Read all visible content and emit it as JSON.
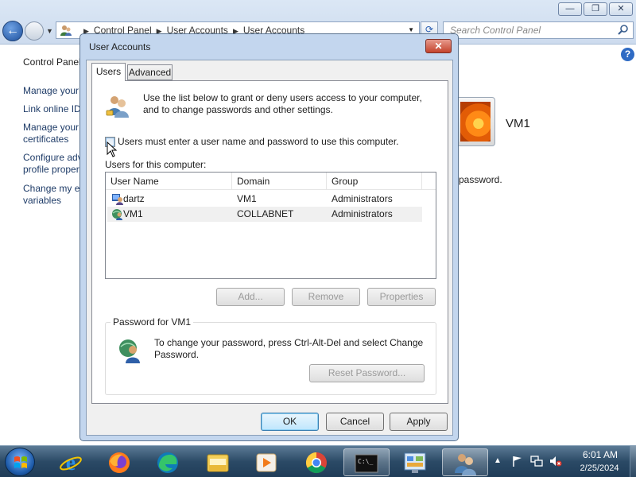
{
  "control_panel": {
    "breadcrumb": [
      "Control Panel",
      "User Accounts",
      "User Accounts"
    ],
    "search_placeholder": "Search Control Panel",
    "sidebar": {
      "home": "Control Panel",
      "links": [
        "Manage your",
        "Link online ID",
        "Manage your",
        "certificates",
        "Configure adv",
        "profile proper",
        "Change my e",
        "variables"
      ]
    },
    "user_tile_name": "VM1",
    "visible_text_fragment": "password."
  },
  "dialog": {
    "title": "User Accounts",
    "tabs": [
      "Users",
      "Advanced"
    ],
    "active_tab": "Users",
    "intro_line1": "Use the list below to grant or deny users access to your computer,",
    "intro_line2": "and to change passwords and other settings.",
    "must_enter_label": "Users must enter a user name and password to use this computer.",
    "must_enter_checked": false,
    "users_label": "Users for this computer:",
    "columns": [
      "User Name",
      "Domain",
      "Group"
    ],
    "rows": [
      {
        "user": "dartz",
        "domain": "VM1",
        "group": "Administrators",
        "icon": "local-user-icon"
      },
      {
        "user": "VM1",
        "domain": "COLLABNET",
        "group": "Administrators",
        "icon": "domain-user-icon"
      }
    ],
    "buttons": {
      "add": "Add...",
      "remove": "Remove",
      "properties": "Properties"
    },
    "password_group": {
      "legend": "Password for VM1",
      "text_line1": "To change your password, press Ctrl-Alt-Del and select Change",
      "text_line2": "Password.",
      "reset": "Reset Password..."
    },
    "footer": {
      "ok": "OK",
      "cancel": "Cancel",
      "apply": "Apply"
    }
  },
  "taskbar": {
    "apps": [
      "internet-explorer",
      "firefox",
      "edge",
      "file-explorer",
      "media-player",
      "chrome",
      "command-prompt",
      "control-panel",
      "user-accounts"
    ],
    "active_app": "user-accounts",
    "clock_time": "6:01 AM",
    "clock_date": "2/25/2024"
  },
  "colors": {
    "accent": "#3c7fb1",
    "title_bar": "#c3d6ee",
    "taskbar": "#2b4a66"
  }
}
